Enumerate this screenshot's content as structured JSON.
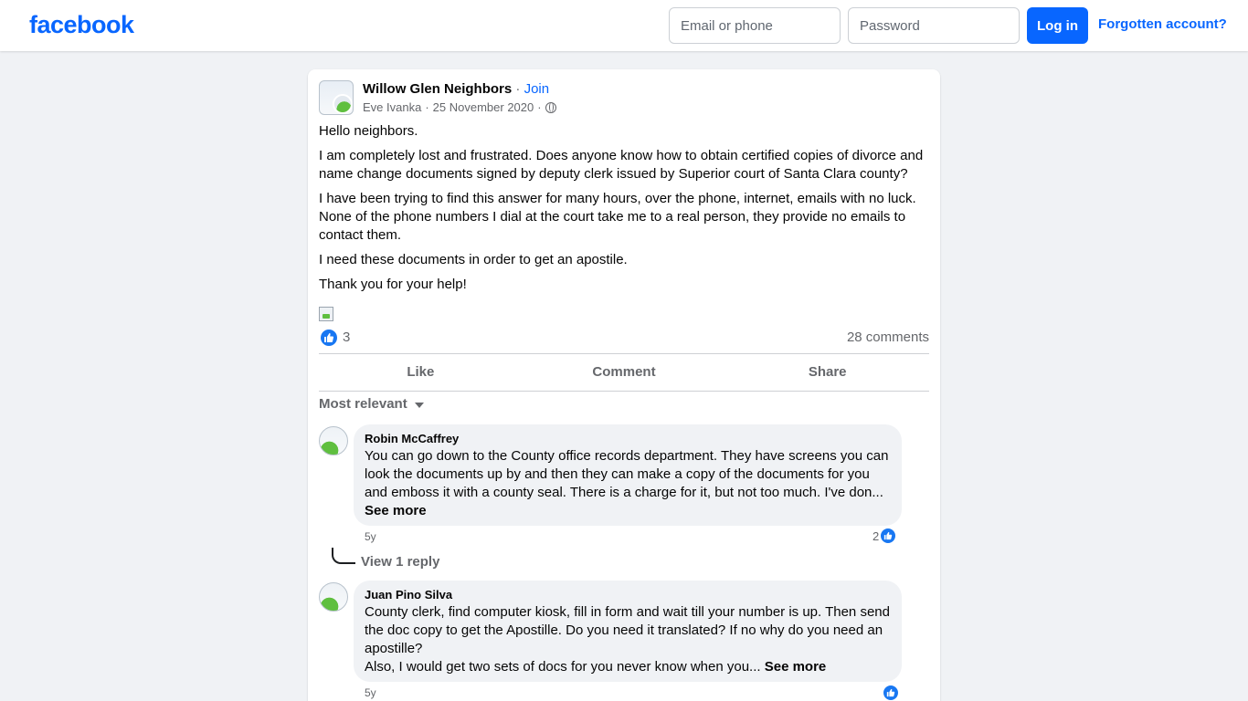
{
  "header": {
    "logo": "facebook",
    "email_placeholder": "Email or phone",
    "password_placeholder": "Password",
    "login_label": "Log in",
    "forgot_label": "Forgotten account?"
  },
  "colors": {
    "brand": "#0866ff",
    "page_bg": "#f0f2f5",
    "secondary_text": "#65676b"
  },
  "post": {
    "group_name": "Willow Glen Neighbors",
    "join_separator": " · ",
    "join_label": "Join",
    "author": "Eve Ivanka",
    "date": "25 November 2020",
    "audience_icon": "globe-icon",
    "paragraphs": [
      "Hello neighbors.",
      "I am completely lost and frustrated. Does anyone know how to obtain certified copies of divorce and name change documents signed by deputy clerk issued by Superior court of Santa Clara county?",
      "I have been trying to find this answer for many hours, over the phone, internet, emails with no luck. None of the phone numbers I dial at the court take me to a real person, they provide no emails to contact them.",
      "I need these documents in order to get an apostile.",
      "Thank you for your help!"
    ],
    "reaction_count": "3",
    "comment_count": "28 comments",
    "actions": {
      "like": "Like",
      "comment": "Comment",
      "share": "Share"
    },
    "sort_label": "Most relevant"
  },
  "comments": [
    {
      "author": "Robin McCaffrey",
      "text": "You can go down to the County office records department. They have screens you can look the documents up by and then they can make a copy of the documents for you and emboss it with a county seal. There is a charge for it, but not too much. I've don...",
      "see_more": "See more",
      "age": "5y",
      "likes": "2",
      "view_replies": "View 1 reply"
    },
    {
      "author": "Juan Pino Silva",
      "text": "County clerk, find computer kiosk, fill in form and wait till your number is up. Then send the doc copy to get the Apostille. Do you need it translated? If no why do you need an apostille?",
      "text_line2": "Also, I would get two sets of docs for you never know when you...",
      "see_more": "See more",
      "age": "5y"
    }
  ]
}
